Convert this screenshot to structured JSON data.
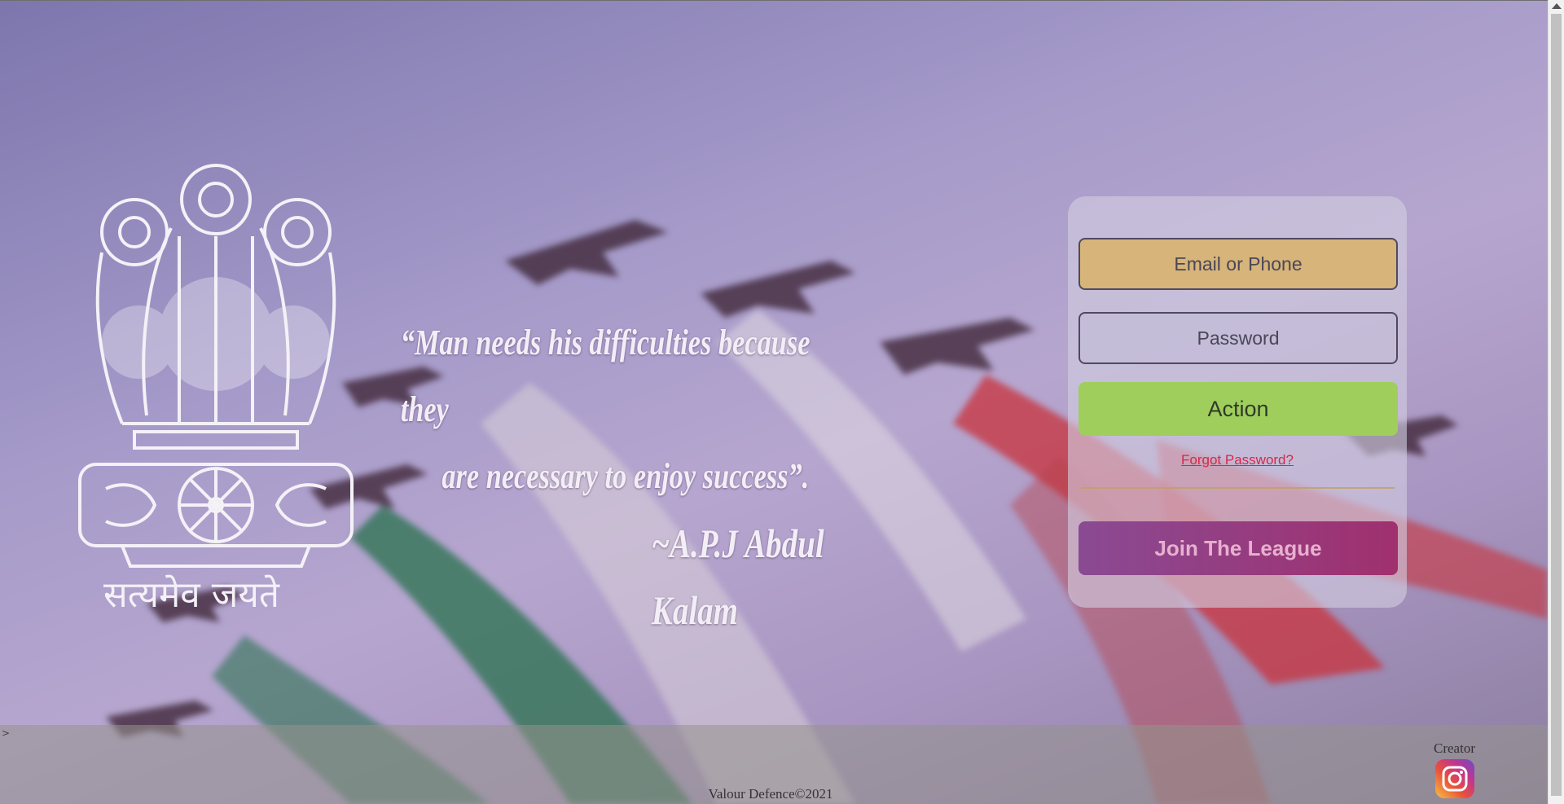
{
  "background": {
    "colors": {
      "sky": "#a59ac9",
      "smoke_green": "#1f6e45",
      "smoke_red": "#c8323b",
      "jets": "#3a2030"
    }
  },
  "emblem": {
    "motto": "सत्यमेव जयते"
  },
  "quote": {
    "line1": "“Man needs his difficulties because they",
    "line2": "are necessary to enjoy success”.",
    "author": "~A.P.J Abdul Kalam"
  },
  "login": {
    "email_placeholder": "Email or Phone",
    "password_placeholder": "Password",
    "action_label": "Action",
    "forgot_label": "Forgot Password?",
    "join_label": "Join The League",
    "colors": {
      "email_bg": "#d6b47a",
      "action_bg": "#9fce5c",
      "join_bg": "#94407f",
      "forgot": "#d62848"
    }
  },
  "footer": {
    "caret": ">",
    "copyright": "Valour Defence©2021",
    "creator_label": "Creator",
    "creator_icon": "instagram-icon"
  }
}
